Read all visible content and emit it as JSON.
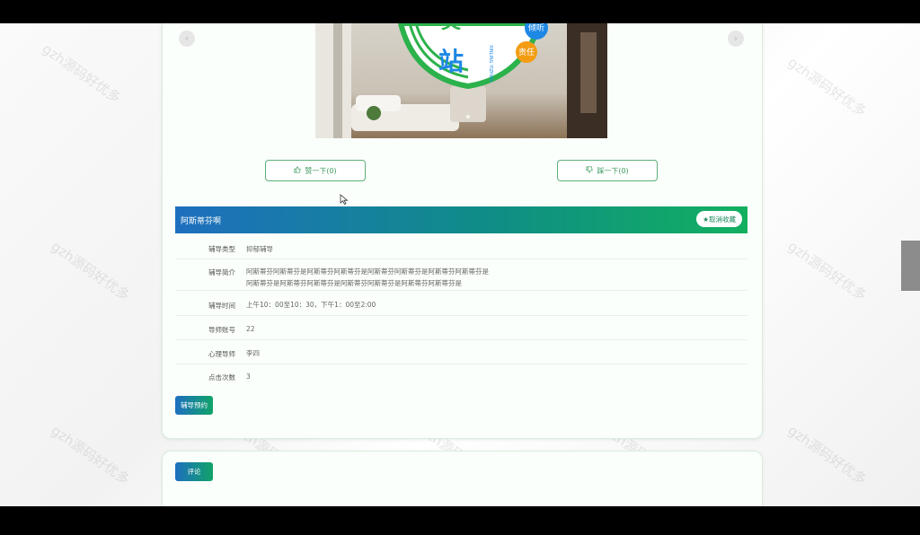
{
  "watermark": "gzh源码好优多",
  "carousel": {
    "prev_icon": "chevron-left-icon",
    "next_icon": "chevron-right-icon",
    "image_text": {
      "big_char": "站",
      "badge_1": "倾听",
      "badge_2": "责任",
      "vertical": "XINLING YIZHAN"
    }
  },
  "votes": {
    "like_label": "赞一下(0)",
    "dislike_label": "踩一下(0)",
    "like_icon": "thumbs-up-icon",
    "dislike_icon": "thumbs-down-icon"
  },
  "detail": {
    "title": "阿斯蒂芬啊",
    "fav_label": "★取消收藏",
    "rows": [
      {
        "label": "辅导类型",
        "value": "抑郁辅导"
      },
      {
        "label": "辅导简介",
        "value": "阿斯蒂芬阿斯蒂芬是阿斯蒂芬阿斯蒂芬是阿斯蒂芬阿斯蒂芬是阿斯蒂芬阿斯蒂芬是阿斯蒂芬是阿斯蒂芬阿斯蒂芬是阿斯蒂芬阿斯蒂芬是阿斯蒂芬阿斯蒂芬是"
      },
      {
        "label": "辅导时间",
        "value": "上午10：00至10：30，下午1：00至2:00"
      },
      {
        "label": "导师账号",
        "value": "22"
      },
      {
        "label": "心理导师",
        "value": "李四"
      },
      {
        "label": "点击次数",
        "value": "3"
      }
    ],
    "book_button": "辅导预约"
  },
  "comment": {
    "button": "评论"
  },
  "colors": {
    "accent_blue": "#1e6fbf",
    "accent_green": "#12b060",
    "border_green": "#5ab07a"
  }
}
